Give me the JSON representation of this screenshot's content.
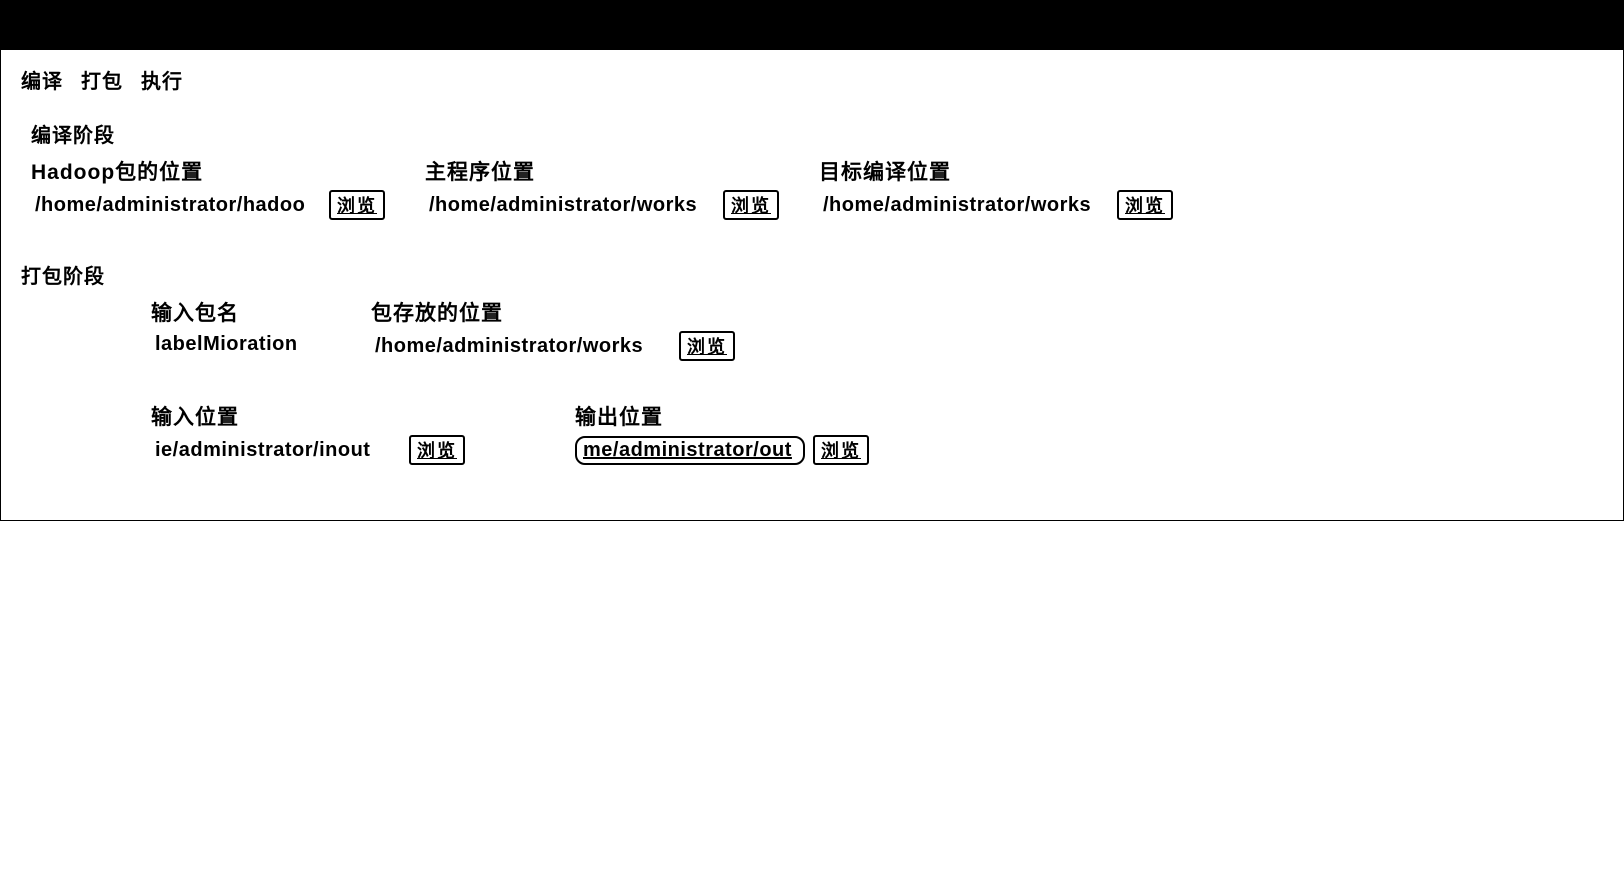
{
  "tabs": {
    "compile": "编译",
    "package": "打包",
    "execute": "执行"
  },
  "compile_section": {
    "title": "编译阶段",
    "hadoop_location": {
      "label": "Hadoop包的位置",
      "value": "/home/administrator/hadoo",
      "browse": "浏览"
    },
    "main_program": {
      "label": "主程序位置",
      "value": "/home/administrator/works",
      "browse": "浏览"
    },
    "target_compile": {
      "label": "目标编译位置",
      "value": "/home/administrator/works",
      "browse": "浏览"
    }
  },
  "package_section": {
    "title": "打包阶段",
    "package_name": {
      "label": "输入包名",
      "value": "labelMioration"
    },
    "package_location": {
      "label": "包存放的位置",
      "value": "/home/administrator/works",
      "browse": "浏览"
    }
  },
  "run_section": {
    "input_location": {
      "label": "输入位置",
      "value": "ie/administrator/inout",
      "browse": "浏览"
    },
    "output_location": {
      "label": "输出位置",
      "value": "me/administrator/out",
      "browse": "浏览"
    }
  }
}
